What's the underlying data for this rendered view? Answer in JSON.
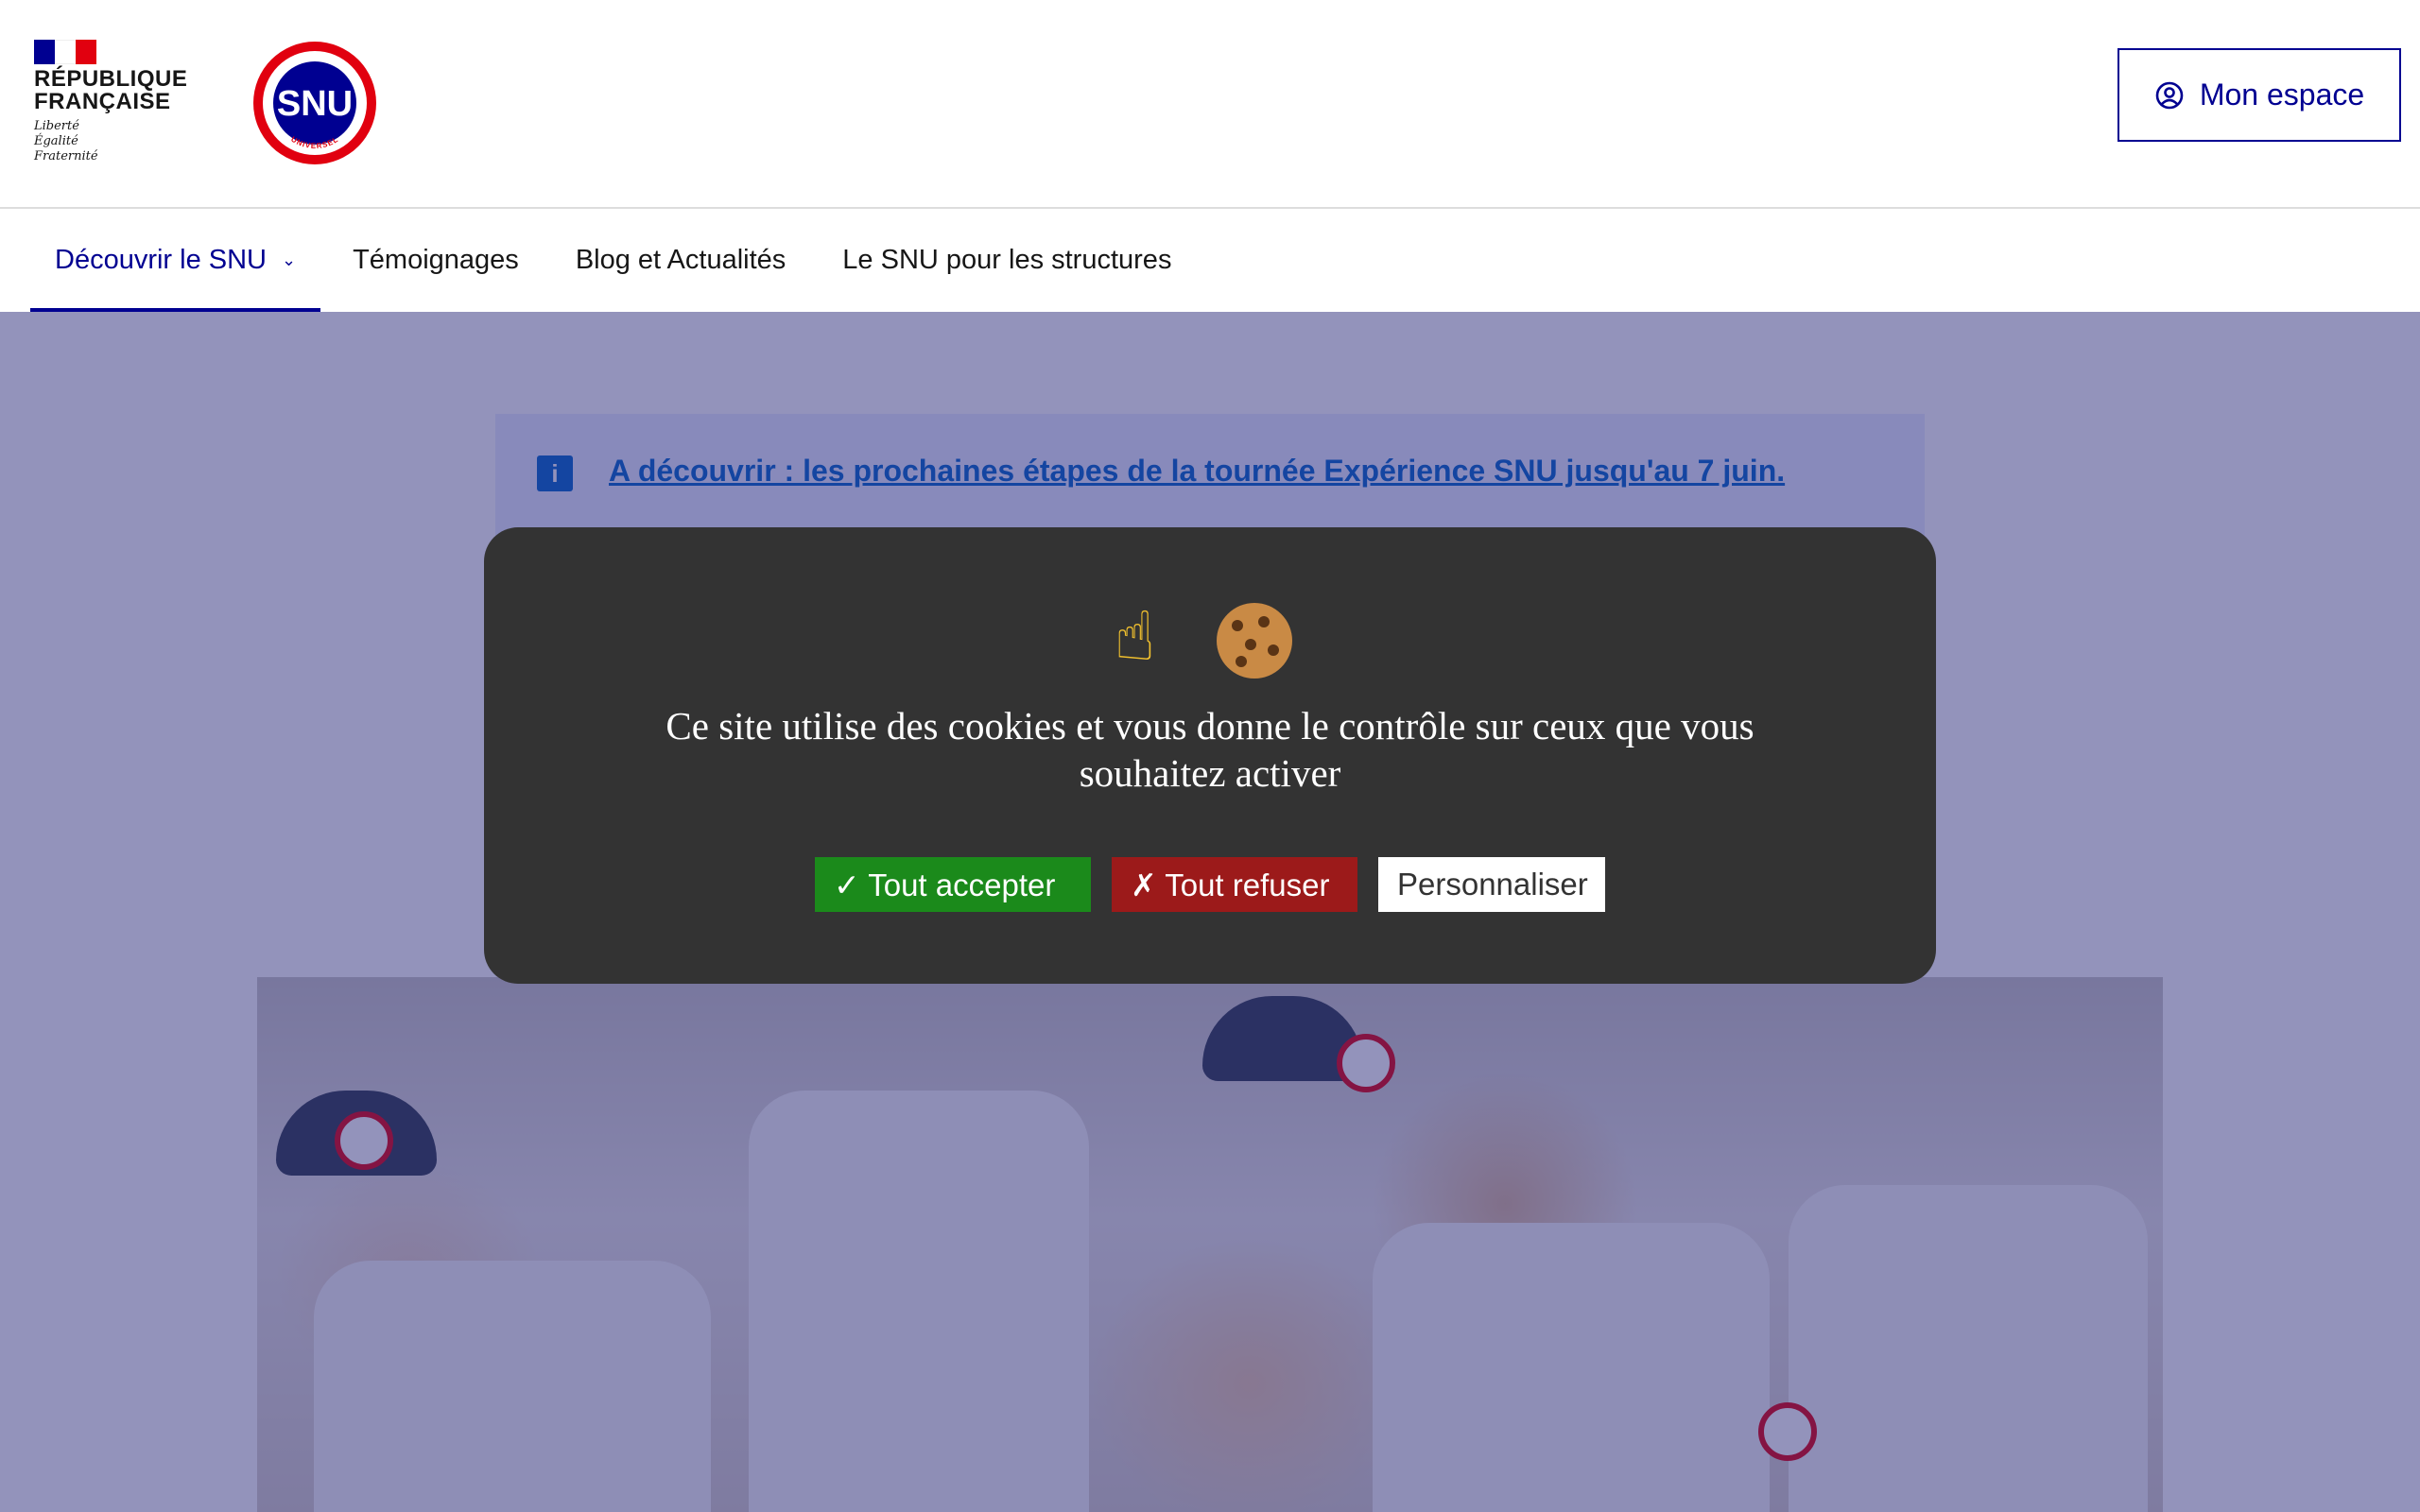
{
  "header": {
    "gov_name_line1": "RÉPUBLIQUE",
    "gov_name_line2": "FRANÇAISE",
    "motto": [
      "Liberté",
      "Égalité",
      "Fraternité"
    ],
    "snu_logo_text": "SNU",
    "snu_logo_ring_top": "SERVICE NATIONAL",
    "snu_logo_ring_bottom": "UNIVERSEL",
    "account_button": "Mon espace"
  },
  "nav": {
    "items": [
      {
        "label": "Découvrir le SNU",
        "active": true,
        "has_dropdown": true
      },
      {
        "label": "Témoignages"
      },
      {
        "label": "Blog et Actualités"
      },
      {
        "label": "Le SNU pour les structures"
      }
    ]
  },
  "notice": {
    "icon": "info-icon",
    "link_text": "A découvrir : les prochaines étapes de la tournée Expérience SNU jusqu'au 7 juin."
  },
  "cookie_banner": {
    "emoji": [
      "☝",
      "🍪"
    ],
    "message": "Ce site utilise des cookies et vous donne le contrôle sur ceux que vous souhaitez activer",
    "accept_label": "✓ Tout accepter",
    "refuse_label": "✗ Tout refuser",
    "customize_label": "Personnaliser"
  },
  "colors": {
    "primary": "#000091",
    "overlay": "#28287880",
    "dialog_bg": "#333333",
    "accept": "#1b8a1b",
    "refuse": "#9c1a1a",
    "info": "#0063cb"
  }
}
